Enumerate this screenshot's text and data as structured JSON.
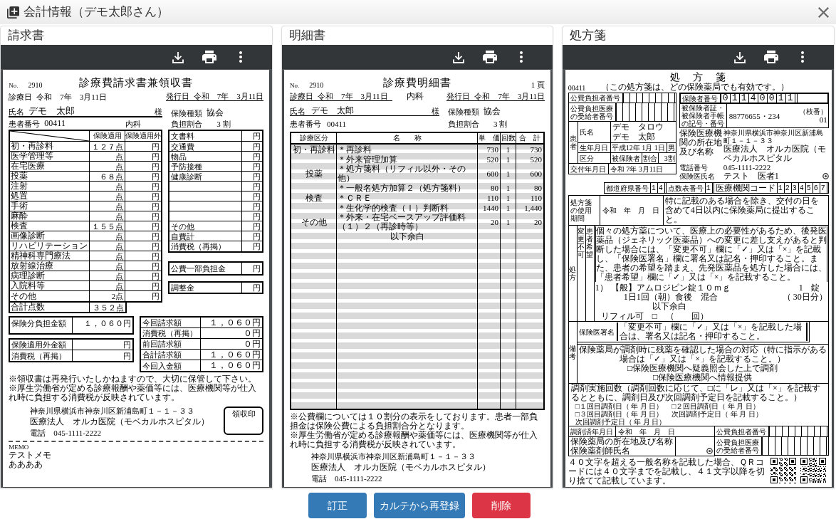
{
  "window": {
    "title": "会計情報（デモ太郎さん）"
  },
  "panels": [
    {
      "kind": "invoice",
      "title": "請求書",
      "document": {
        "no_label": "No.",
        "no": "2910",
        "title": "診療費請求書兼領収書",
        "visit_date_label": "診療日",
        "visit_date": "令和　7年　3月11日",
        "issue_date_label": "発行日",
        "issue_date": "令和　7年　3月11日",
        "name_label": "氏名",
        "name": "デモ　太郎",
        "honorific": "様",
        "insurance_label": "保険種類",
        "insurance": "協会",
        "patient_no_label": "患者番号",
        "patient_no": "00411",
        "department": "内科",
        "ratio_label": "負担割合",
        "ratio": "3 割",
        "columns": [
          "保険適用",
          "保険適用外"
        ],
        "rows": [
          {
            "label": "初・再診料",
            "points": "１２７点",
            "other": "円"
          },
          {
            "label": "医学管理等",
            "points": "点",
            "other": "円"
          },
          {
            "label": "在宅医療",
            "points": "点",
            "other": "円"
          },
          {
            "label": "投薬",
            "points": "６８点",
            "other": "円"
          },
          {
            "label": "注射",
            "points": "点",
            "other": "円"
          },
          {
            "label": "処置",
            "points": "点",
            "other": "円"
          },
          {
            "label": "手術",
            "points": "点",
            "other": "円"
          },
          {
            "label": "麻酔",
            "points": "点",
            "other": "円"
          },
          {
            "label": "検査",
            "points": "１５５点",
            "other": "円"
          },
          {
            "label": "画像診断",
            "points": "点",
            "other": "円"
          },
          {
            "label": "リハビリテーション",
            "points": "点",
            "other": "円"
          },
          {
            "label": "精神科専門療法",
            "points": "点",
            "other": "円"
          },
          {
            "label": "放射線治療",
            "points": "点",
            "other": "円"
          },
          {
            "label": "病理診断",
            "points": "点",
            "other": "円"
          },
          {
            "label": "入院料等",
            "points": "点",
            "other": "円"
          },
          {
            "label": "その他",
            "points": "2点",
            "other": "円"
          }
        ],
        "total": {
          "label": "合計点数",
          "points": "３５２点"
        },
        "extra_rows": [
          {
            "label": "文書料",
            "value": "円"
          },
          {
            "label": "交通費",
            "value": "円"
          },
          {
            "label": "物品",
            "value": "円"
          },
          {
            "label": "予防接種",
            "value": "円"
          },
          {
            "label": "健康診断",
            "value": "円"
          },
          {
            "value": "円"
          },
          {
            "value": "円"
          },
          {
            "value": "円"
          },
          {
            "value": "円"
          },
          {
            "label": "その他",
            "value": "円"
          },
          {
            "label": "自費計",
            "value": "円"
          },
          {
            "label": "消費税（再掲）",
            "value": "円"
          }
        ],
        "public_burden": {
          "label": "公費一部負担金",
          "value": "円"
        },
        "adjustment": {
          "label": "調整金",
          "value": "円"
        },
        "insured_amount": {
          "label": "保険分負担金額",
          "value": "１，０６０円"
        },
        "uninsured": [
          {
            "label": "保険適用外金額",
            "value": "円"
          },
          {
            "label": "消費税（再掲）",
            "value": "円"
          }
        ],
        "summary": [
          {
            "label": "今回請求額",
            "value": "１，０６０円"
          },
          {
            "label": "消費税（再掲）",
            "value": "０円"
          },
          {
            "label": "前回請求額",
            "value": "０円"
          },
          {
            "label": "合計請求額",
            "value": "１，０６０円"
          },
          {
            "label": "今回入金額",
            "value": "１，０６０円"
          }
        ],
        "notes": [
          "※領収書は再発行いたしかねますので、大切に保管して下さい。",
          "※厚生労働省が定める診療報酬や薬価等には、医療機関等が仕入れ時に負担する消費税が反映されています。"
        ],
        "clinic": {
          "address": "神奈川県横浜市神奈川区新浦島町１－１－３３",
          "name": "医療法人　オルカ医院（モベカルホスピタル）",
          "phone": "電話　045-1111-2222"
        },
        "stamp_label": "領収印",
        "memo_label": "MEMO",
        "memo": [
          "テストメモ",
          "ああああ"
        ]
      }
    },
    {
      "kind": "statement",
      "title": "明細書",
      "document": {
        "no_label": "No.",
        "no": "2910",
        "title": "診療費明細書",
        "page": "1 頁",
        "visit_date_label": "診療日",
        "visit_date": "令和　7年　3月11日",
        "department": "内科",
        "issue_date_label": "発行日",
        "issue_date": "令和　7年　3月11日",
        "name_label": "氏名",
        "name": "デモ　太郎",
        "honorific": "様",
        "insurance_label": "保険種類",
        "insurance": "協会",
        "patient_no_label": "患者番号",
        "patient_no": "00411",
        "ratio_label": "負担割合",
        "ratio": "3 割",
        "columns": [
          "診療区分",
          "名　　称",
          "単　価",
          "回数",
          "合　計"
        ],
        "rows": [
          {
            "category": "初・再診料",
            "name": "＊再診料",
            "price": "730",
            "count": "1",
            "total": "730"
          },
          {
            "name": "＊外来管理加算",
            "price": "520",
            "count": "1",
            "total": "520"
          },
          {
            "category": "投薬",
            "name": "＊処方箋料（リフィル以外・その他）",
            "price": "600",
            "count": "1",
            "total": "600"
          },
          {
            "name": "＊一般名処方加算２（処方箋料）",
            "price": "80",
            "count": "1",
            "total": "80"
          },
          {
            "category": "検査",
            "name": "＊ＣＲＥ",
            "price": "110",
            "count": "1",
            "total": "110"
          },
          {
            "name": "＊生化学的検査（Ｉ）判断料",
            "price": "1440",
            "count": "1",
            "total": "1,440"
          },
          {
            "category": "その他",
            "name": "＊外来・在宅ベースアップ評価料（１）２（再診時等）",
            "price": "20",
            "count": "1",
            "total": "20"
          }
        ],
        "end_mark": "以下余白",
        "notes": [
          "※公費欄については１０割分の表示をしております。患者一部負担金は保険公費による負担割合分となります。",
          "※厚生労働省が定める診療報酬や薬価等には、医療機関等が仕入れ時に負担する消費税が反映されています。"
        ],
        "clinic": {
          "address": "神奈川県横浜市神奈川区新浦島町１－１－３３",
          "name": "医療法人　オルカ医院（モベカルホスピタル）",
          "phone": "電話　045-1111-2222"
        }
      }
    },
    {
      "kind": "prescription",
      "title": "処方箋",
      "document": {
        "title": "処　方　箋",
        "subtitle": "（この処方箋は、どの保険薬局でも有効です。）",
        "patient_no": "00411",
        "public_payer_label": "公費負担者番号",
        "recipient_label": "公費負担医療の受給者番号",
        "insurer_label": "保険者番号",
        "insurer_no": "01140011",
        "card_label": "被保険者証・被保険者手帳の記号・番号",
        "card_no": "88776655・234",
        "branch_label": "（枝番）",
        "branch": "01",
        "patient_label": "患者",
        "name_label": "氏名",
        "name_kana": "デモ　タロウ",
        "name": "デモ　太郎",
        "birth_label": "生年月日",
        "birth": "平成12年 1月 1日",
        "sex": "男",
        "category_label": "区分",
        "category": "被保険者",
        "ratio_label": "割合",
        "ratio": "3割",
        "issue_label": "交付年月日",
        "issue_date": "令和 7年 3月11日",
        "clinic_label": "保険医療機関の所在地及び名称",
        "clinic_address": "神奈川県横浜市神奈川区新浦島町１－１－３３",
        "clinic_name": "医療法人　オルカ医院（モベカルホスピタル",
        "phone_label": "電話番号",
        "phone": "045-1111-2222",
        "doctor_label": "保険医氏名",
        "doctor": "テスト　医者1",
        "pref_label": "都道府県番号",
        "pref": "14",
        "table_label": "点数表番号",
        "table": "1",
        "code_label": "医療機関コード",
        "code": "1234567",
        "period_label": "処方箋の使用期間",
        "period": "令和　年　月　日",
        "period_note": "特に記載のある場合を除き、交付の日を含めて4日以内に保険薬局に提出すること。",
        "rx_label": "処方",
        "col_labels": [
          "変更不可",
          "患者希望"
        ],
        "rx_note": "個々の処方薬について、医療上の必要性があるため、後発医薬品（ジェネリック医薬品）への変更に差し支えがあると判断した場合には、「変更不可」欄に「✓」又は「×」を記載し、「保険医署名」欄に署名又は記名・押印すること。また、患者の希望を踏まえ、先発医薬品を処方した場合には、「患者希望」欄に「✓」又は「×」を記載すること。",
        "rx_items": [
          {
            "no": "1）",
            "drug": "【般】アムロジピン錠１０ｍｇ",
            "qty": "1",
            "unit": "錠",
            "usage": "1日1回（朝）食後　混合",
            "days": "（ 30日分）"
          }
        ],
        "rx_end": "以下余白",
        "refill": "リフィル可　□　（　　回）",
        "remarks_label": "備考",
        "signature_label": "保険医署名",
        "signature_note": "「変更不可」欄に「✓」又は「×」を記載した場合は、署名又は記名・押印すること。",
        "leftover_note": "保険薬局が調剤時に残薬を確認した場合の対応（特に指示がある場合は「✓」又は「×」を記載すること。）",
        "leftover_options": [
          "□保険医療機関へ疑義照会した上で調剤",
          "□保険医療機関へ情報提供"
        ],
        "dispense_note": "調剤実施回数（調剤回数に応じて、□に「レ」又は「×」を記載するとともに、調剤日及び次回調剤予定日を記載すること。）",
        "dispense_items": [
          "□１回目調剤日（ 年 月 日）",
          "□２回目調剤日（ 年 月 日）",
          "□３回目調剤日（ 年 月 日）",
          "次回調剤予定日（ 年 月 日）",
          "次回調剤予定日（ 年 月 日）"
        ],
        "dispensed_label": "調剤済年月日",
        "dispensed": "令和　年　月　日",
        "pharmacy_label": [
          "保険薬局の所在地及び名称",
          "保険薬剤師氏名"
        ],
        "public_payer2_label": "公費負担者番号",
        "recipient2_label": "公費負担医療の受給者番号",
        "qr_note": "４０文字を超える一般名称を記載した場合、ＱＲコードには４０文字までを記載し、４１文字以降を切り捨てて記載しています。"
      }
    }
  ],
  "buttons": [
    {
      "label": "訂正",
      "kind": "primary"
    },
    {
      "label": "カルテから再登録",
      "kind": "primary"
    },
    {
      "label": "削除",
      "kind": "danger"
    }
  ]
}
